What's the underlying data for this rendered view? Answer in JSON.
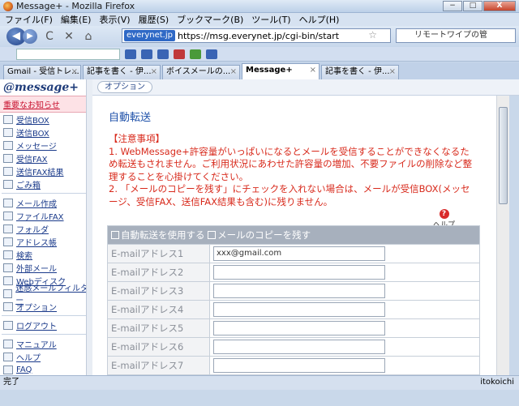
{
  "window": {
    "title": "Message+ - Mozilla Firefox",
    "minimize": "−",
    "maximize": "□",
    "close": "X"
  },
  "menu": [
    "ファイル(F)",
    "編集(E)",
    "表示(V)",
    "履歴(S)",
    "ブックマーク(B)",
    "ツール(T)",
    "ヘルプ(H)"
  ],
  "address": {
    "site_id": "everynet.jp",
    "url": "https://msg.everynet.jp/cgi-bin/start",
    "search_placeholder": "リモートワイプの管"
  },
  "tabs": [
    {
      "label": "Gmail - 受信トレ..."
    },
    {
      "label": "記事を書く - 伊..."
    },
    {
      "label": "ボイスメールの..."
    },
    {
      "label": "Message+",
      "active": true
    },
    {
      "label": "記事を書く - 伊..."
    }
  ],
  "sidebar": {
    "logo": "@message+",
    "notice": "重要なお知らせ",
    "items": [
      "受信BOX",
      "送信BOX",
      "メッセージ",
      "受信FAX",
      "送信FAX結果",
      "ごみ箱"
    ],
    "items2": [
      "メール作成",
      "ファイルFAX",
      "フォルダ",
      "アドレス帳",
      "検索",
      "外部メール",
      "Webディスク",
      "迷惑メールフィルター",
      "オプション"
    ],
    "items3": [
      "ログアウト"
    ],
    "items4": [
      "マニュアル",
      "ヘルプ",
      "FAQ"
    ]
  },
  "option_button": "オプション",
  "main": {
    "title": "自動転送",
    "caution_head": "【注意事項】",
    "caution_1": "1. WebMessage+許容量がいっぱいになるとメールを受信することができなくなるため転送もされません。ご利用状況にあわせた許容量の増加、不要ファイルの削除など整理することを心掛けてください。",
    "caution_2": "2. 「メールのコピーを残す」にチェックを入れない場合は、メールが受信BOX(メッセージ、受信FAX、送信FAX結果も含む)に残りません。",
    "help_label": "ヘルプ",
    "chk_forward": "自動転送を使用する",
    "chk_copy": "メールのコピーを残す",
    "rows": [
      {
        "label": "E-mailアドレス1",
        "value": "xxx@gmail.com"
      },
      {
        "label": "E-mailアドレス2",
        "value": ""
      },
      {
        "label": "E-mailアドレス3",
        "value": ""
      },
      {
        "label": "E-mailアドレス4",
        "value": ""
      },
      {
        "label": "E-mailアドレス5",
        "value": ""
      },
      {
        "label": "E-mailアドレス6",
        "value": ""
      },
      {
        "label": "E-mailアドレス7",
        "value": ""
      }
    ]
  },
  "status": {
    "left": "完了",
    "right": "itokoichi"
  }
}
